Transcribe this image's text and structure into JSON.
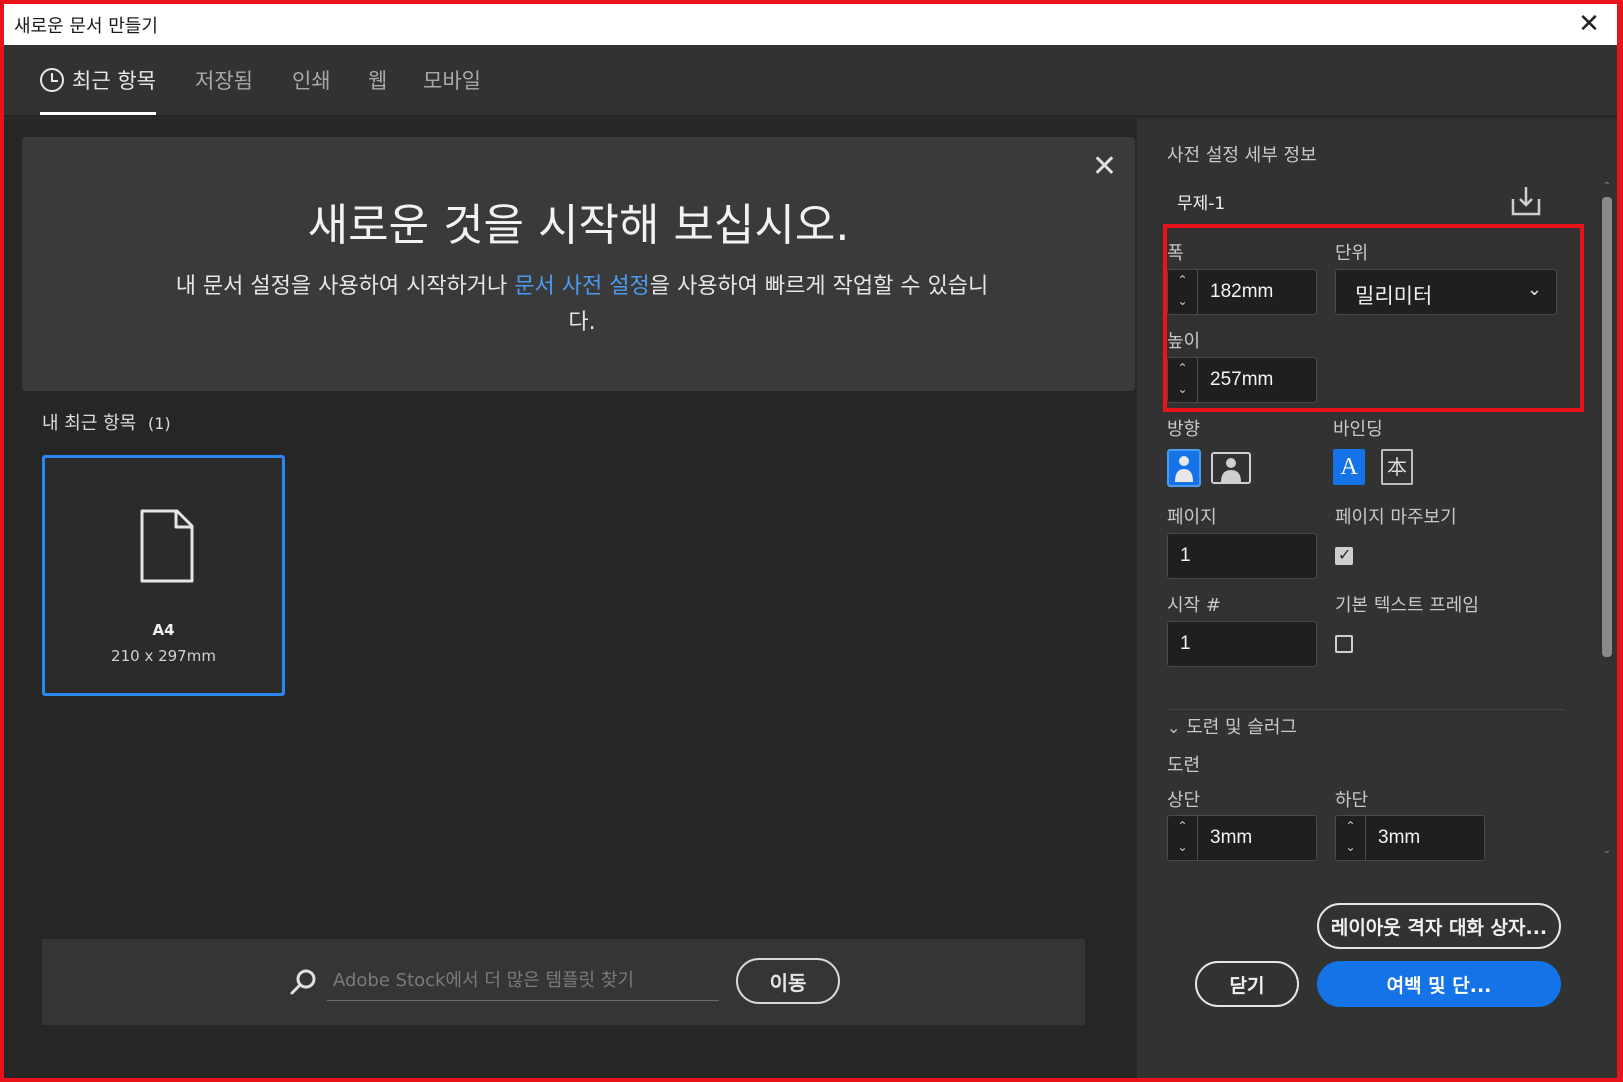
{
  "window": {
    "title": "새로운 문서 만들기",
    "close_glyph": "✕"
  },
  "tabs": [
    {
      "label": "최근 항목",
      "active": true
    },
    {
      "label": "저장됨",
      "active": false
    },
    {
      "label": "인쇄",
      "active": false
    },
    {
      "label": "웹",
      "active": false
    },
    {
      "label": "모바일",
      "active": false
    }
  ],
  "hero": {
    "title": "새로운 것을 시작해 보십시오.",
    "desc_before": "내 문서 설정을 사용하여 시작하거나 ",
    "desc_link": "문서 사전 설정",
    "desc_after": "을 사용하여 빠르게 작업할 수 있습니다.",
    "close_glyph": "✕"
  },
  "recent": {
    "heading": "내 최근 항목",
    "count": "(1)",
    "items": [
      {
        "name": "A4",
        "size": "210 x 297mm"
      }
    ]
  },
  "stock_search": {
    "placeholder": "Adobe Stock에서 더 많은 템플릿 찾기",
    "value": "",
    "go_label": "이동"
  },
  "preset": {
    "section_title": "사전 설정 세부 정보",
    "doc_name": "무제-1",
    "width_label": "폭",
    "width_value": "182mm",
    "unit_label": "단위",
    "unit_value": "밀리미터",
    "height_label": "높이",
    "height_value": "257mm",
    "orientation_label": "방향",
    "orientation_selected": "portrait",
    "binding_label": "바인딩",
    "binding_selected": "left-to-right",
    "binding_ltr_glyph": "A",
    "binding_rtl_glyph": "本",
    "pages_label": "페이지",
    "pages_value": "1",
    "facing_pages_label": "페이지 마주보기",
    "facing_pages_checked": true,
    "start_label": "시작 #",
    "start_value": "1",
    "primary_text_frame_label": "기본 텍스트 프레임",
    "primary_text_frame_checked": false,
    "bleed_slug_section": "도련 및 슬러그",
    "bleed_label": "도련",
    "top_label": "상단",
    "top_value": "3mm",
    "bottom_label": "하단",
    "bottom_value": "3mm"
  },
  "buttons": {
    "layout_grid": "레이아웃 격자 대화 상자...",
    "close": "닫기",
    "margins_columns": "여백 및 단..."
  },
  "colors": {
    "accent": "#1473e6",
    "highlight": "#e8141a",
    "card_border": "#2b86f0",
    "link": "#4a9bf0"
  }
}
